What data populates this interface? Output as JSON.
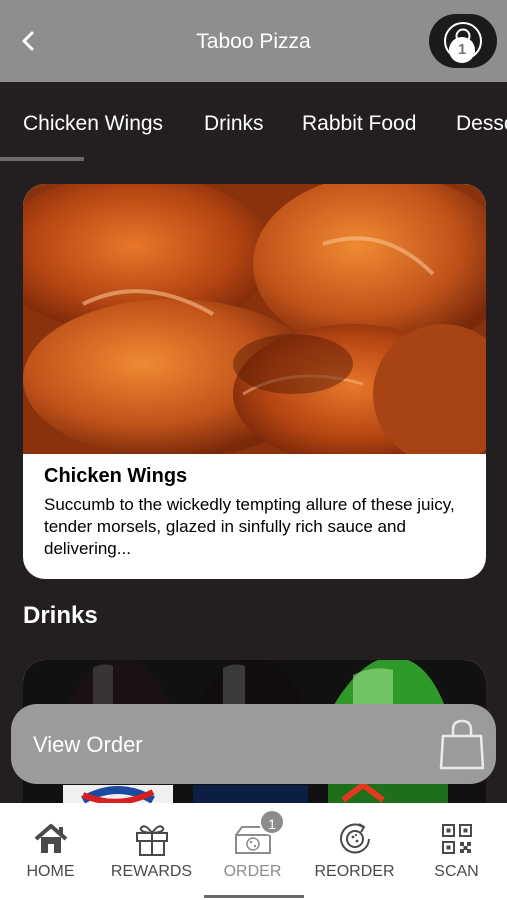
{
  "header": {
    "title": "Taboo Pizza"
  },
  "tabs": [
    {
      "label": "Chicken Wings"
    },
    {
      "label": "Drinks"
    },
    {
      "label": "Rabbit Food"
    },
    {
      "label": "Desse"
    }
  ],
  "card": {
    "title": "Chicken Wings",
    "description": "Succumb to the wickedly tempting allure of these juicy, tender morsels, glazed in sinfully rich sauce and delivering..."
  },
  "section": {
    "title": "Drinks"
  },
  "view_order": {
    "label": "View Order",
    "count": "1"
  },
  "bottom_nav": {
    "items": [
      {
        "label": "HOME",
        "icon": "home-icon"
      },
      {
        "label": "REWARDS",
        "icon": "gift-icon"
      },
      {
        "label": "ORDER",
        "icon": "pizza-box-icon",
        "badge": "1"
      },
      {
        "label": "REORDER",
        "icon": "reorder-icon"
      },
      {
        "label": "SCAN",
        "icon": "qr-code-icon"
      }
    ]
  },
  "colors": {
    "header": "#8e8e8e",
    "background": "#231f20",
    "bar": "#9b9b9b"
  }
}
